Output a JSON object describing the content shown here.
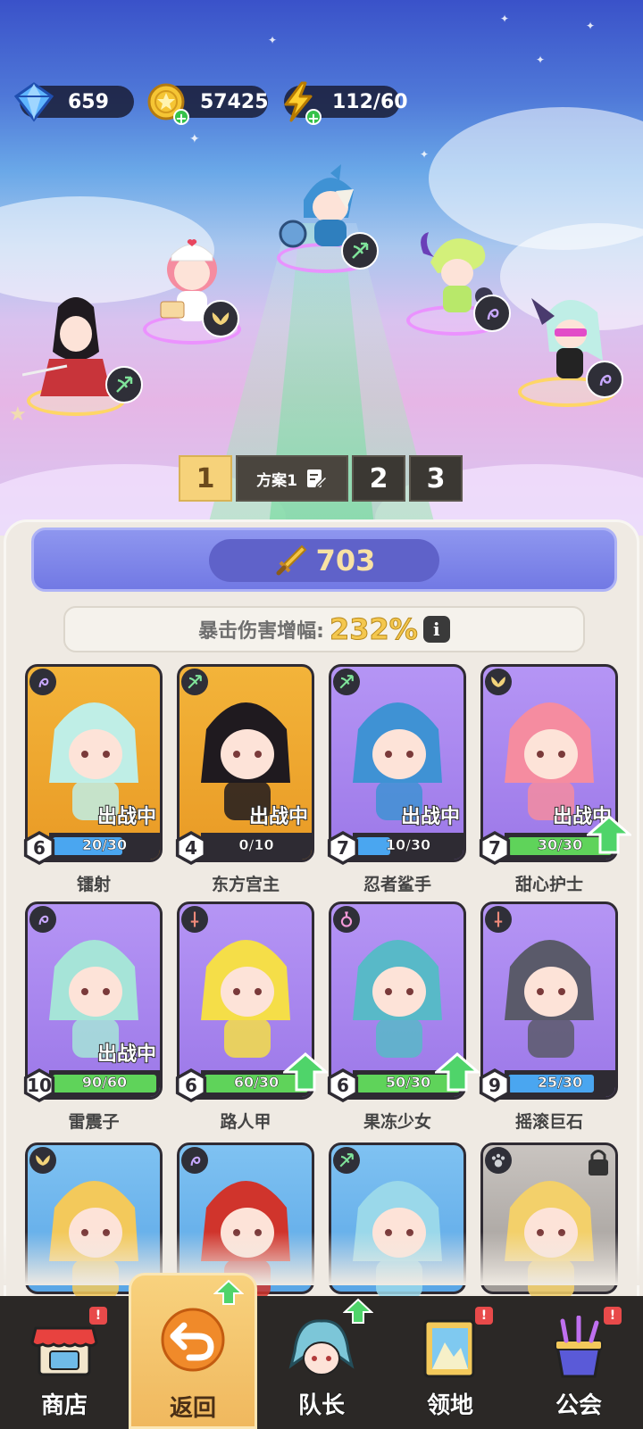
{
  "resources": {
    "gems": "659",
    "coins": "57425",
    "energy": "112/60"
  },
  "plans": {
    "active": "1",
    "name": "方案1",
    "others": [
      "2",
      "3"
    ]
  },
  "power": "703",
  "crit": {
    "label": "暴击伤害增幅:",
    "value": "232%"
  },
  "heroes": [
    {
      "name": "镭射",
      "level": "6",
      "progress": "20/30",
      "progress_fraction": 0.67,
      "deployed": "出战中",
      "class_icon": "magic-icon",
      "theme": "gold",
      "upgrade": false
    },
    {
      "name": "东方宫主",
      "level": "4",
      "progress": "0/10",
      "progress_fraction": 0.0,
      "deployed": "出战中",
      "class_icon": "bow-icon",
      "theme": "gold",
      "upgrade": false
    },
    {
      "name": "忍者鲨手",
      "level": "7",
      "progress": "10/30",
      "progress_fraction": 0.33,
      "deployed": "出战中",
      "class_icon": "bow-icon",
      "theme": "purple",
      "upgrade": false
    },
    {
      "name": "甜心护士",
      "level": "7",
      "progress": "30/30",
      "progress_fraction": 1.0,
      "deployed": "出战中",
      "class_icon": "wings-icon",
      "theme": "purple",
      "upgrade": true
    },
    {
      "name": "雷震子",
      "level": "10",
      "progress": "90/60",
      "progress_fraction": 1.0,
      "deployed": "出战中",
      "class_icon": "magic-icon",
      "theme": "purple",
      "upgrade": false
    },
    {
      "name": "路人甲",
      "level": "6",
      "progress": "60/30",
      "progress_fraction": 1.0,
      "deployed": "",
      "class_icon": "sword-icon",
      "theme": "purple",
      "upgrade": true
    },
    {
      "name": "果冻少女",
      "level": "6",
      "progress": "50/30",
      "progress_fraction": 1.0,
      "deployed": "",
      "class_icon": "potion-icon",
      "theme": "purple",
      "upgrade": true
    },
    {
      "name": "摇滚巨石",
      "level": "9",
      "progress": "25/30",
      "progress_fraction": 0.83,
      "deployed": "",
      "class_icon": "sword-icon",
      "theme": "purple",
      "upgrade": false
    },
    {
      "name": "",
      "class_icon": "wings-icon",
      "theme": "blue"
    },
    {
      "name": "",
      "class_icon": "magic-icon",
      "theme": "blue"
    },
    {
      "name": "",
      "class_icon": "bow-icon",
      "theme": "blue"
    },
    {
      "name": "",
      "class_icon": "paw-icon",
      "theme": "grey",
      "locked": true
    }
  ],
  "nav": [
    {
      "label": "商店",
      "icon": "shop-icon",
      "badge": "!"
    },
    {
      "label": "返回",
      "icon": "return-icon",
      "active": true,
      "upgrade": true
    },
    {
      "label": "队长",
      "icon": "captain-icon",
      "upgrade": true
    },
    {
      "label": "领地",
      "icon": "territory-icon",
      "badge": "!"
    },
    {
      "label": "公会",
      "icon": "guild-icon",
      "badge": "!"
    }
  ],
  "colors": {
    "panel": "#efeae3",
    "power_bar": "#7c82e8",
    "crit_value": "#f4c74e",
    "bar_blue": "#4aa6f0",
    "bar_green": "#5fd35a",
    "nav": "#2b2826",
    "nav_active": "#f4c46b"
  }
}
